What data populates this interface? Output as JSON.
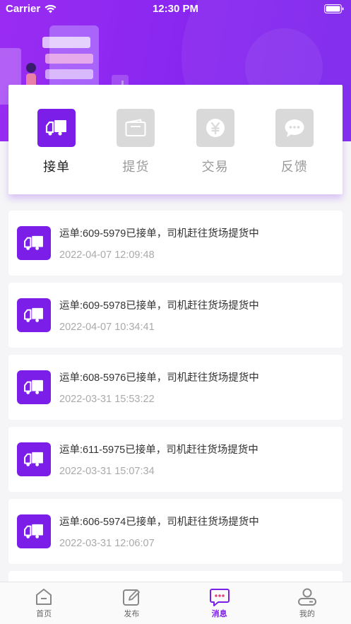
{
  "status_bar": {
    "carrier": "Carrier",
    "time": "12:30 PM"
  },
  "colors": {
    "accent": "#7a1ee8",
    "hero_start": "#9a2cf2",
    "hero_end": "#7b22ec",
    "inactive_icon_bg": "#d9d9d9"
  },
  "categories": [
    {
      "label": "接单",
      "icon": "truck-icon",
      "active": true
    },
    {
      "label": "提货",
      "icon": "wallet-icon",
      "active": false
    },
    {
      "label": "交易",
      "icon": "yen-icon",
      "active": false
    },
    {
      "label": "反馈",
      "icon": "chat-icon",
      "active": false
    }
  ],
  "messages": [
    {
      "title": "运单:609-5979已接单，司机赶往货场提货中",
      "time": "2022-04-07 12:09:48"
    },
    {
      "title": "运单:609-5978已接单，司机赶往货场提货中",
      "time": "2022-04-07 10:34:41"
    },
    {
      "title": "运单:608-5976已接单，司机赶往货场提货中",
      "time": "2022-03-31 15:53:22"
    },
    {
      "title": "运单:611-5975已接单，司机赶往货场提货中",
      "time": "2022-03-31 15:07:34"
    },
    {
      "title": "运单:606-5974已接单，司机赶往货场提货中",
      "time": "2022-03-31 12:06:07"
    }
  ],
  "tabbar": [
    {
      "label": "首页",
      "icon": "home-icon",
      "active": false
    },
    {
      "label": "发布",
      "icon": "edit-icon",
      "active": false
    },
    {
      "label": "消息",
      "icon": "message-icon",
      "active": true
    },
    {
      "label": "我的",
      "icon": "profile-icon",
      "active": false
    }
  ]
}
